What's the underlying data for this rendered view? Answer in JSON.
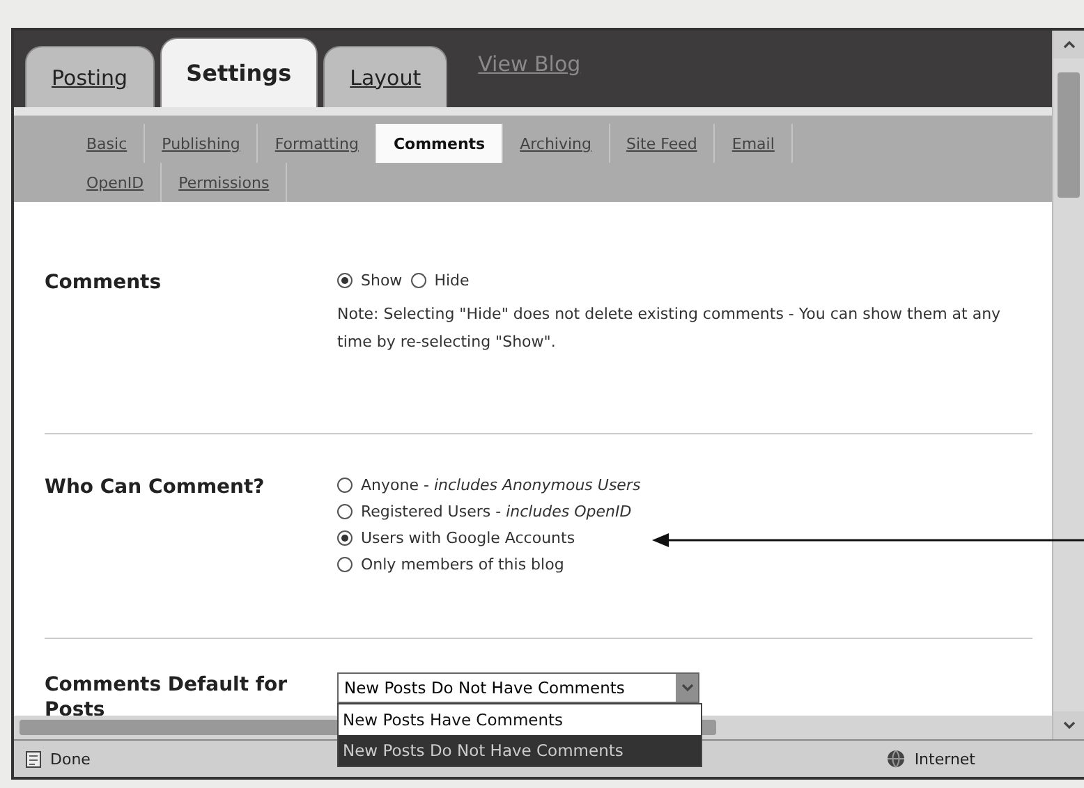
{
  "tabs": [
    {
      "label": "Posting",
      "selected": false
    },
    {
      "label": "Settings",
      "selected": true
    },
    {
      "label": "Layout",
      "selected": false
    }
  ],
  "view_blog_link": "View Blog",
  "subtabs": [
    [
      {
        "label": "Basic",
        "selected": false
      },
      {
        "label": "Publishing",
        "selected": false
      },
      {
        "label": "Formatting",
        "selected": false
      },
      {
        "label": "Comments",
        "selected": true
      },
      {
        "label": "Archiving",
        "selected": false
      },
      {
        "label": "Site Feed",
        "selected": false
      },
      {
        "label": "Email",
        "selected": false
      }
    ],
    [
      {
        "label": "OpenID",
        "selected": false
      },
      {
        "label": "Permissions",
        "selected": false
      }
    ]
  ],
  "comments": {
    "label": "Comments",
    "options": [
      {
        "label": "Show",
        "selected": true
      },
      {
        "label": "Hide",
        "selected": false
      }
    ],
    "note": "Note: Selecting \"Hide\" does not delete existing comments - You can show them at any time by re-selecting \"Show\"."
  },
  "who_can_comment": {
    "label": "Who Can Comment?",
    "options": [
      {
        "label": "Anyone - *includes Anonymous Users*",
        "selected": false
      },
      {
        "label": "Registered Users - *includes OpenID*",
        "selected": false
      },
      {
        "label": "Users with Google Accounts",
        "selected": true
      },
      {
        "label": "Only members of this blog",
        "selected": false
      }
    ]
  },
  "comments_default": {
    "label": "Comments Default for Posts",
    "value": "New Posts Do Not Have Comments",
    "expanded": true,
    "options": [
      {
        "label": "New Posts Have Comments",
        "selected": false
      },
      {
        "label": "New Posts Do Not Have Comments",
        "selected": true
      }
    ]
  },
  "status_bar": {
    "status": "Done",
    "zone": "Internet"
  }
}
